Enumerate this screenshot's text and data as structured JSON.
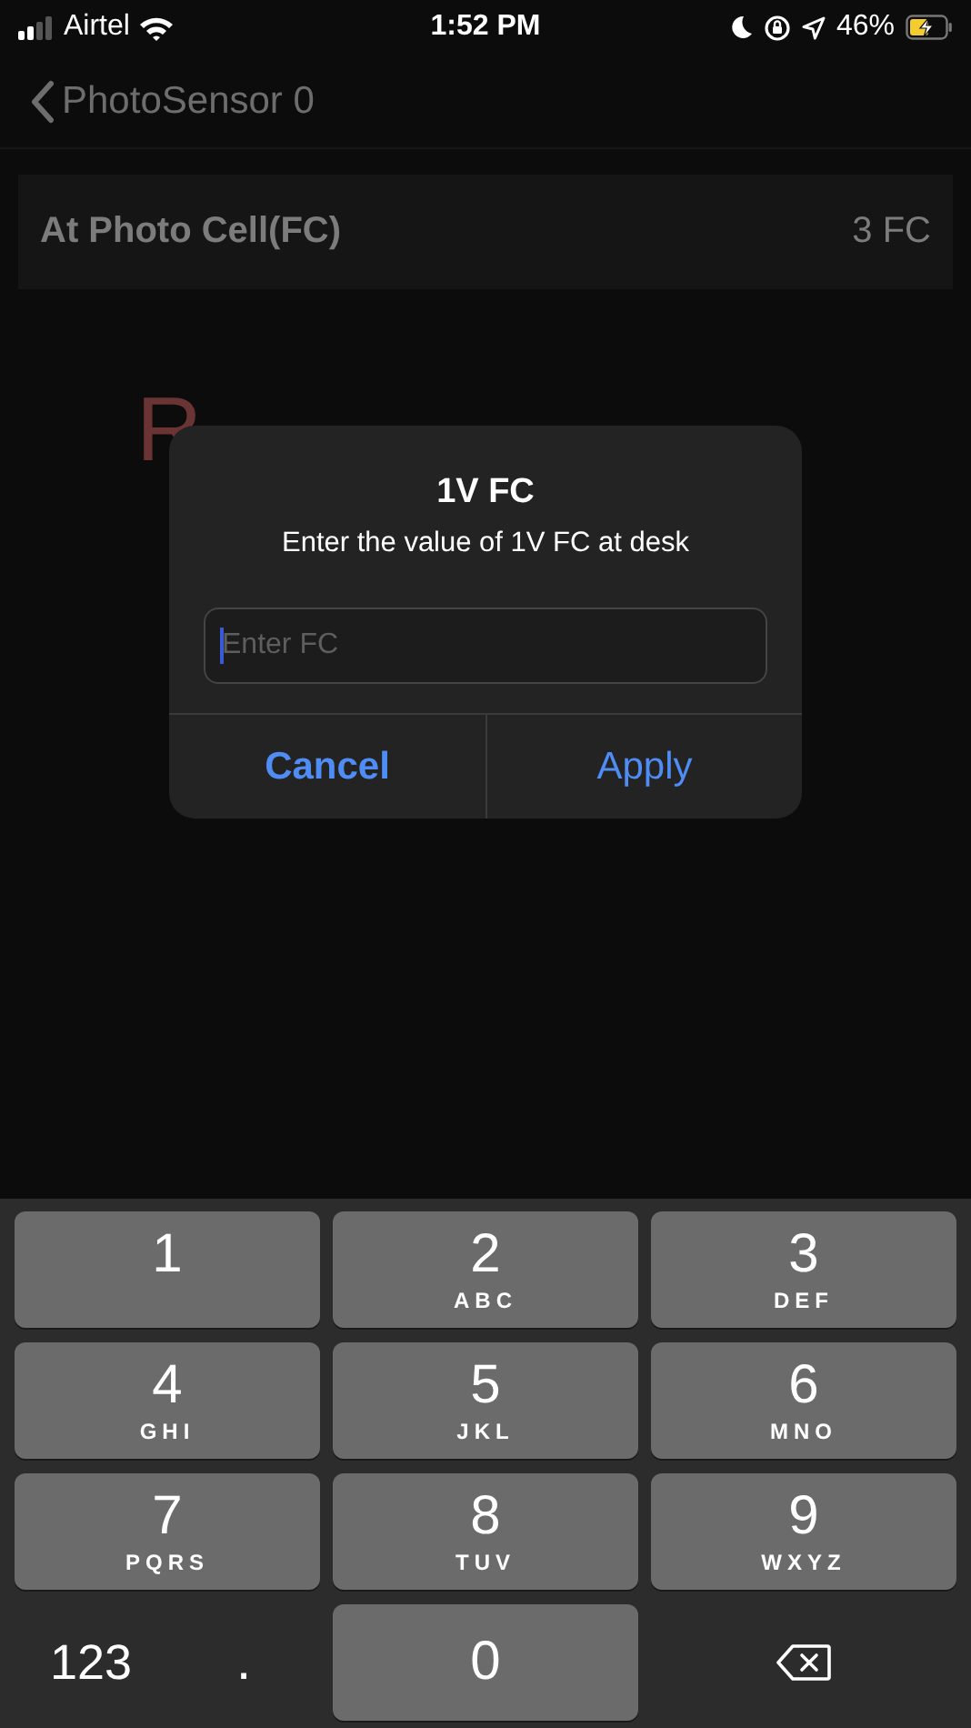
{
  "status_bar": {
    "carrier": "Airtel",
    "time": "1:52 PM",
    "battery": "46%"
  },
  "nav": {
    "back_title": "PhotoSensor 0"
  },
  "setting_row": {
    "label": "At Photo Cell(FC)",
    "value": "3 FC"
  },
  "background_text": [
    "R"
  ],
  "dialog": {
    "title": "1V FC",
    "message": "Enter the value of 1V FC at desk",
    "field": {
      "placeholder": "Enter FC",
      "focused": true
    },
    "buttons": [
      {
        "label": "Cancel",
        "kind": "cancel"
      },
      {
        "label": "Apply",
        "kind": "default"
      }
    ]
  },
  "keypad": {
    "rows": [
      [
        {
          "digit": "1"
        },
        {
          "digit": "2",
          "letters": "ABC"
        },
        {
          "digit": "3",
          "letters": "DEF"
        }
      ],
      [
        {
          "digit": "4",
          "letters": "GHI"
        },
        {
          "digit": "5",
          "letters": "JKL"
        },
        {
          "digit": "6",
          "letters": "MNO"
        }
      ],
      [
        {
          "digit": "7",
          "letters": "PQRS"
        },
        {
          "digit": "8",
          "letters": "TUV"
        },
        {
          "digit": "9",
          "letters": "WXYZ"
        }
      ]
    ],
    "bottom": [
      {
        "kind": "mode",
        "label": "123"
      },
      {
        "kind": "symbol",
        "label": "."
      },
      {
        "kind": "digit",
        "label": "0"
      },
      {
        "kind": "delete"
      }
    ]
  }
}
